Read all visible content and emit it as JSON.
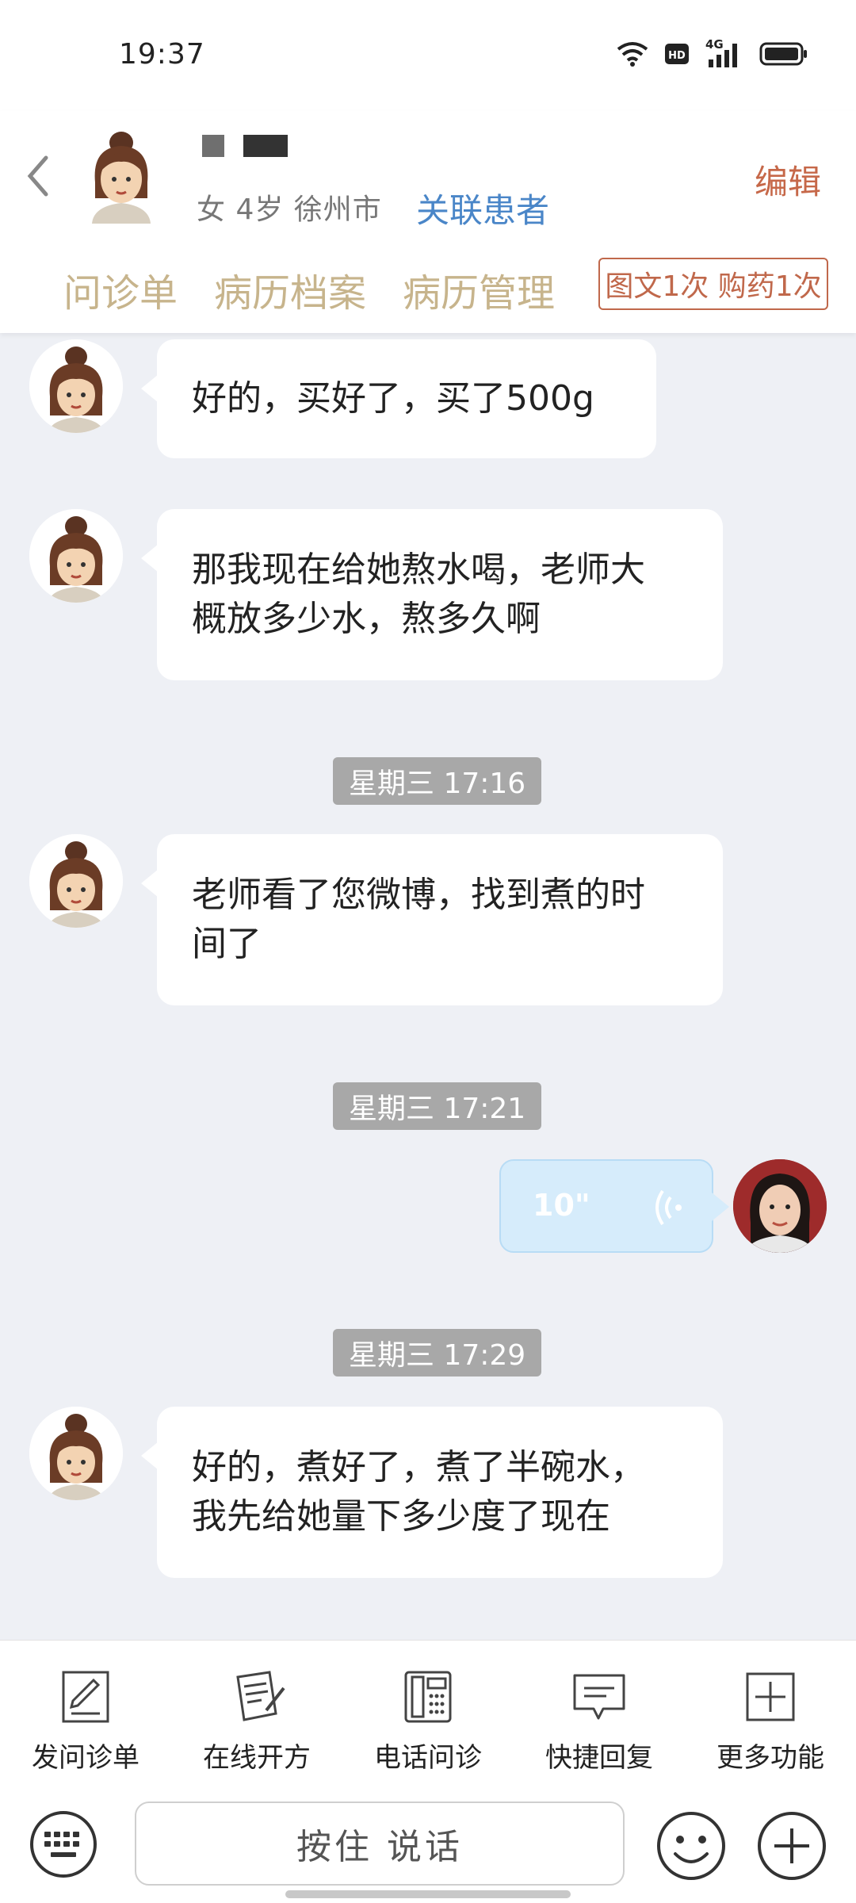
{
  "status_bar": {
    "time": "19:37",
    "network": "4G"
  },
  "header": {
    "patient_info": "女 4岁  徐州市",
    "link_patient_label": "关联患者",
    "edit_label": "编辑",
    "tabs": [
      "问诊单",
      "病历档案",
      "病历管理"
    ],
    "badge": "图文1次 购药1次"
  },
  "chat": {
    "messages": [
      {
        "text": "好的，买好了，买了500g"
      },
      {
        "line1": "那我现在给她熬水喝，老师大",
        "line2": "概放多少水，熬多久啊"
      },
      {
        "timestamp": "星期三 17:16"
      },
      {
        "line1": "老师看了您微博，找到煮的时",
        "line2": "间了"
      },
      {
        "timestamp": "星期三 17:21"
      },
      {
        "voice_duration": "10\""
      },
      {
        "timestamp": "星期三 17:29"
      },
      {
        "line1": "好的，煮好了，煮了半碗水，",
        "line2": "我先给她量下多少度了现在"
      }
    ]
  },
  "toolbar": {
    "items": [
      {
        "label": "发问诊单",
        "icon": "form-edit-icon"
      },
      {
        "label": "在线开方",
        "icon": "prescription-icon"
      },
      {
        "label": "电话问诊",
        "icon": "phone-icon"
      },
      {
        "label": "快捷回复",
        "icon": "quick-reply-icon"
      },
      {
        "label": "更多功能",
        "icon": "more-plus-icon"
      }
    ]
  },
  "input": {
    "hold_to_talk": "按住 说话"
  },
  "colors": {
    "accent_tab": "#c7b48c",
    "edit": "#c66849",
    "link": "#4a86c8",
    "voice_bubble": "#d6ecfb"
  }
}
